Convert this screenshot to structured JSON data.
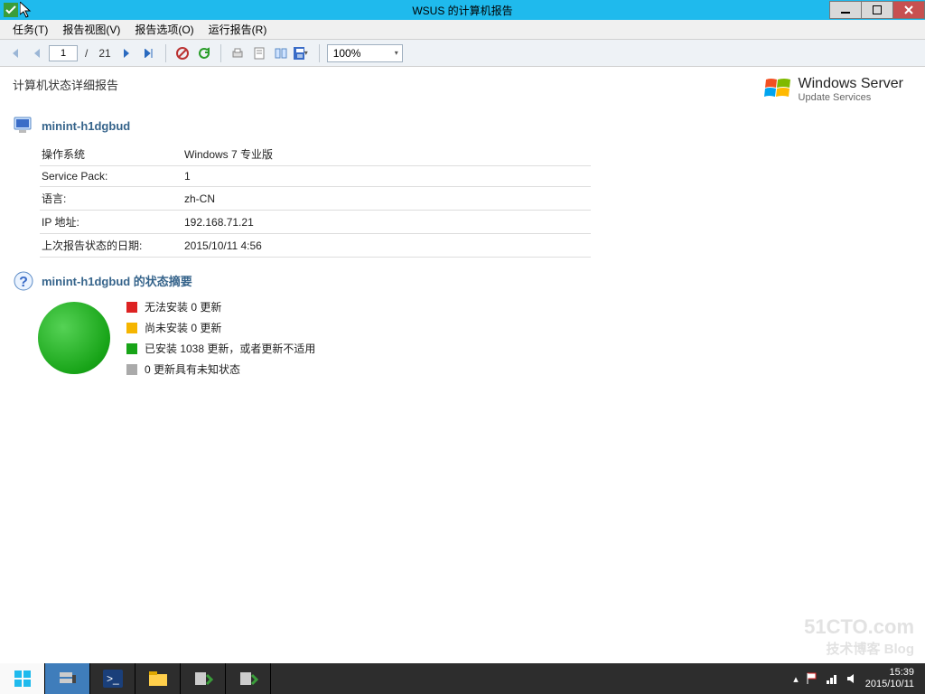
{
  "window": {
    "title": "WSUS 的计算机报告"
  },
  "menubar": {
    "items": [
      "任务(T)",
      "报告视图(V)",
      "报告选项(O)",
      "运行报告(R)"
    ]
  },
  "toolbar": {
    "page_current": "1",
    "page_sep": "/",
    "page_total": "21",
    "zoom": "100%"
  },
  "report": {
    "title": "计算机状态详细报告",
    "brand_line1": "Windows Server",
    "brand_line2": "Update Services",
    "computer_section_title": "minint-h1dgbud",
    "info": [
      {
        "label": "操作系统",
        "value": "Windows 7 专业版"
      },
      {
        "label": "Service Pack:",
        "value": "1"
      },
      {
        "label": "语言:",
        "value": "zh-CN"
      },
      {
        "label": "IP 地址:",
        "value": "192.168.71.21"
      },
      {
        "label": "上次报告状态的日期:",
        "value": "2015/10/11 4:56"
      }
    ],
    "summary_section_title": "minint-h1dgbud 的状态摘要",
    "legend": {
      "red": "无法安装 0 更新",
      "yellow": "尚未安装 0 更新",
      "green": "已安装 1038 更新，或者更新不适用",
      "gray": "0 更新具有未知状态"
    }
  },
  "taskbar": {
    "time": "15:39",
    "date": "2015/10/11"
  },
  "watermark": {
    "line1": "51CTO.com",
    "line2": "技术博客 Blog"
  },
  "colors": {
    "titlebar": "#1fbaed",
    "accent": "#36648b",
    "status_green": "#18a418"
  }
}
